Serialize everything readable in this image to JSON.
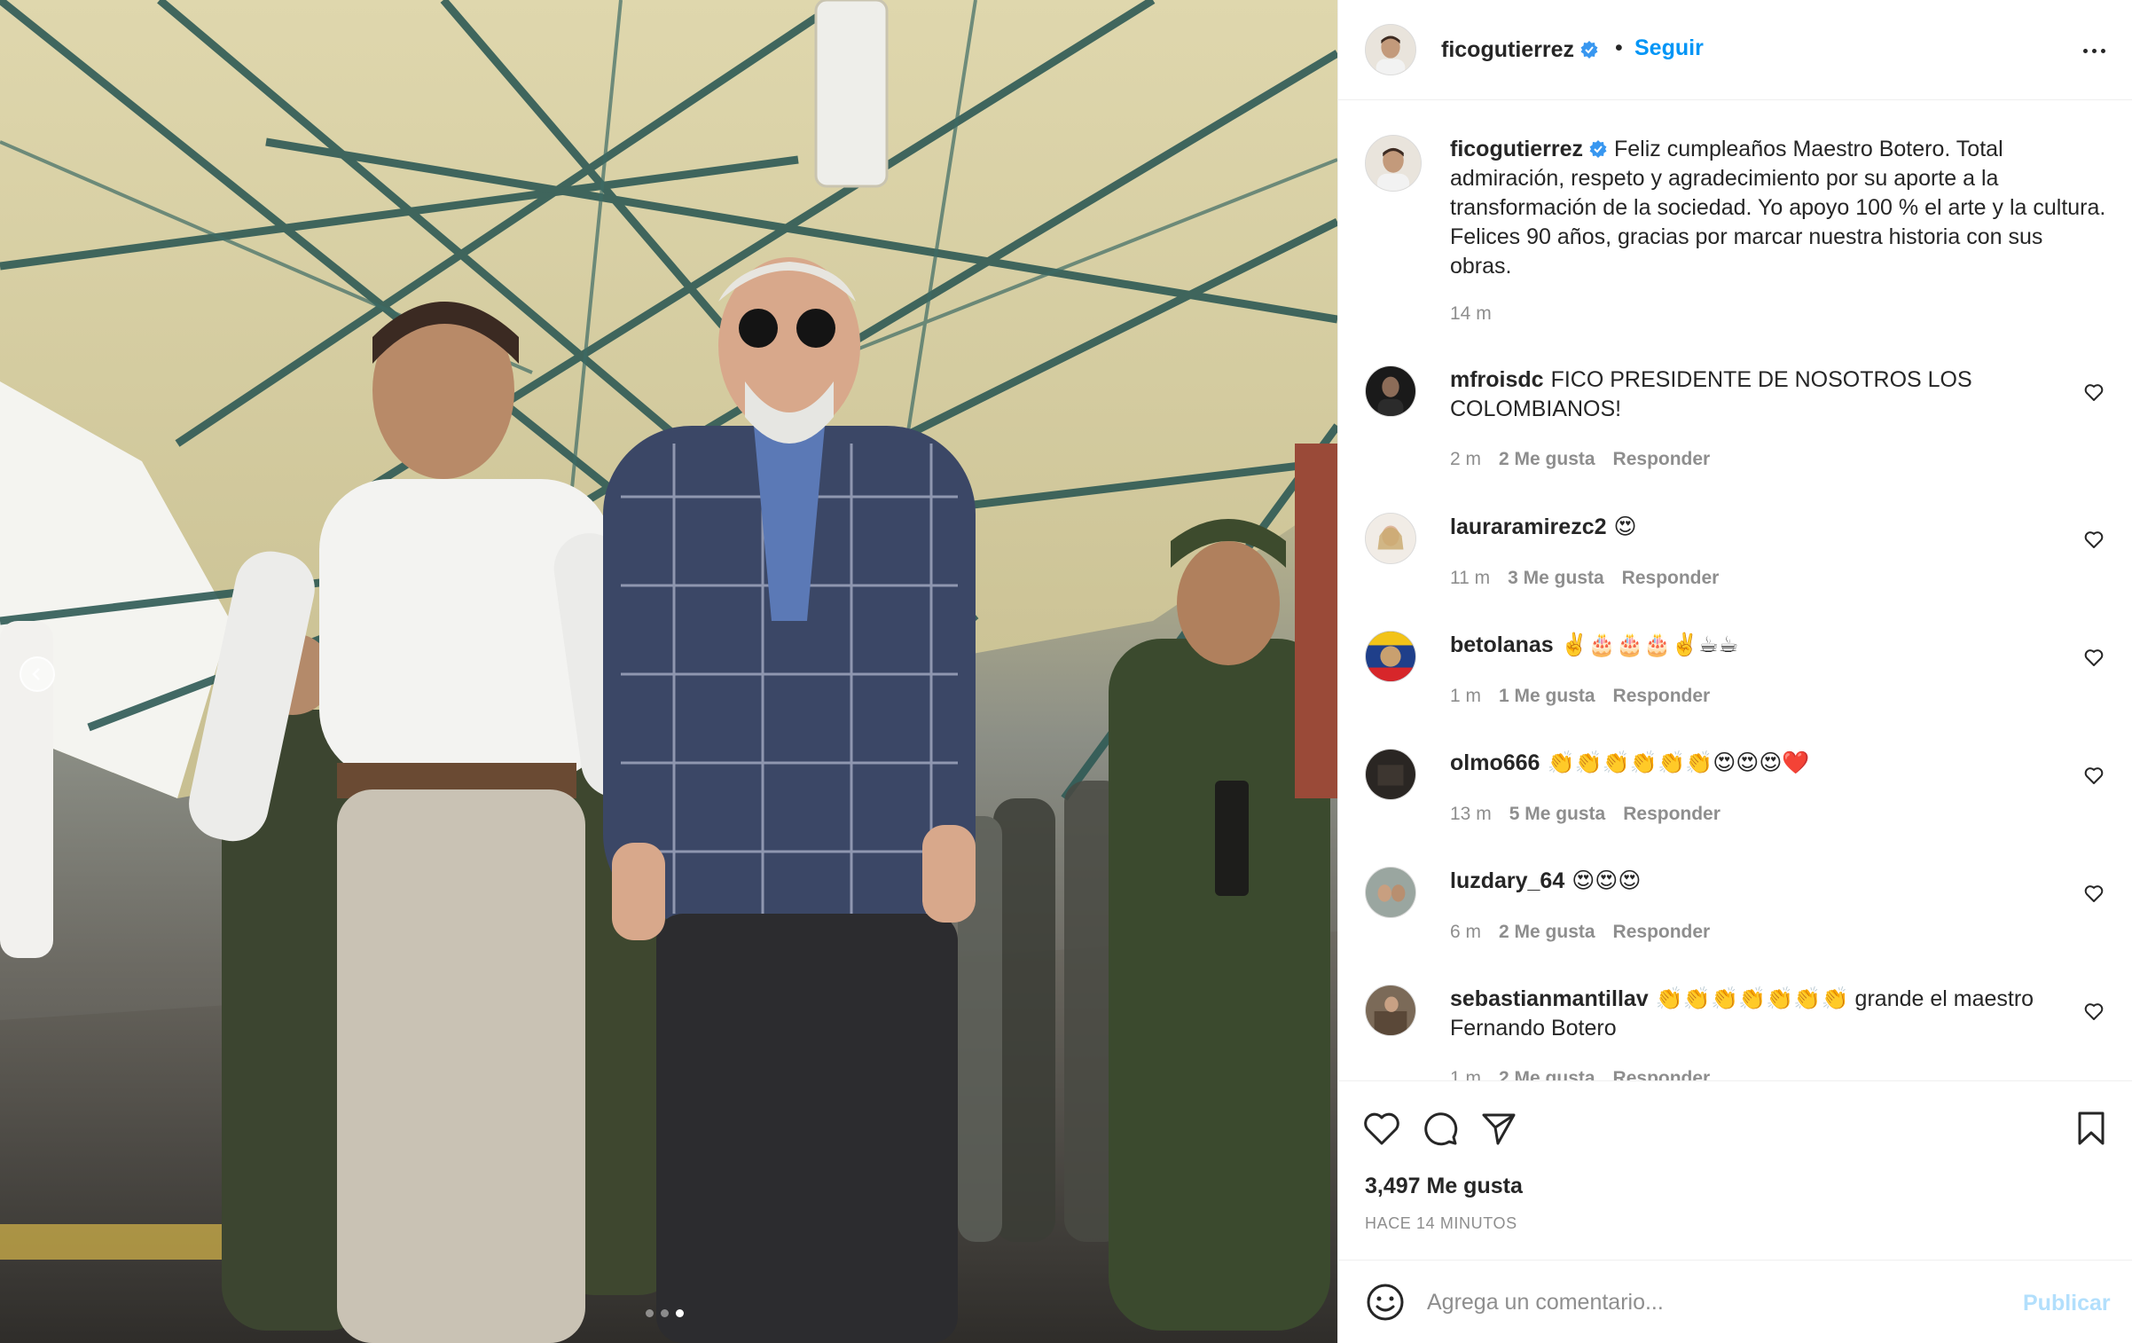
{
  "post": {
    "username": "ficogutierrez",
    "verified": true,
    "separator": "•",
    "follow_label": "Seguir",
    "caption": "Feliz cumpleaños Maestro Botero. Total admiración, respeto y agradecimiento por su aporte a la transformación de la sociedad. Yo apoyo 100 % el arte y la cultura. Felices 90 años, gracias por marcar nuestra historia con sus obras.",
    "caption_time": "14 m",
    "likes": "3,497 Me gusta",
    "timestamp": "HACE 14 MINUTOS"
  },
  "comments": [
    {
      "username": "mfroisdc",
      "text": "FICO PRESIDENTE DE NOSOTROS LOS COLOMBIANOS!",
      "time": "2 m",
      "likes": "2 Me gusta",
      "reply": "Responder"
    },
    {
      "username": "lauraramirezc2",
      "text": "😍",
      "time": "11 m",
      "likes": "3 Me gusta",
      "reply": "Responder"
    },
    {
      "username": "betolanas",
      "text": "✌️🎂🎂🎂✌️☕☕",
      "time": "1 m",
      "likes": "1 Me gusta",
      "reply": "Responder"
    },
    {
      "username": "olmo666",
      "text": "👏👏👏👏👏👏😍😍😍❤️",
      "time": "13 m",
      "likes": "5 Me gusta",
      "reply": "Responder"
    },
    {
      "username": "luzdary_64",
      "text": "😍😍😍",
      "time": "6 m",
      "likes": "2 Me gusta",
      "reply": "Responder"
    },
    {
      "username": "sebastianmantillav",
      "text": "👏👏👏👏👏👏👏 grande el maestro Fernando Botero",
      "time": "1 m",
      "likes": "2 Me gusta",
      "reply": "Responder"
    }
  ],
  "input": {
    "placeholder": "Agrega un comentario...",
    "publish_label": "Publicar"
  },
  "carousel": {
    "current_index": 3,
    "total": 3
  },
  "icons": {
    "more": "more-options-icon",
    "like": "heart-icon",
    "comment": "comment-icon",
    "share": "share-icon",
    "save": "bookmark-icon",
    "emoji": "emoji-icon",
    "prev": "chevron-left-icon"
  },
  "colors": {
    "link": "#0095f6",
    "publish_disabled": "#b2dffc",
    "muted": "#8e8e8e",
    "verified": "#3897f0"
  }
}
